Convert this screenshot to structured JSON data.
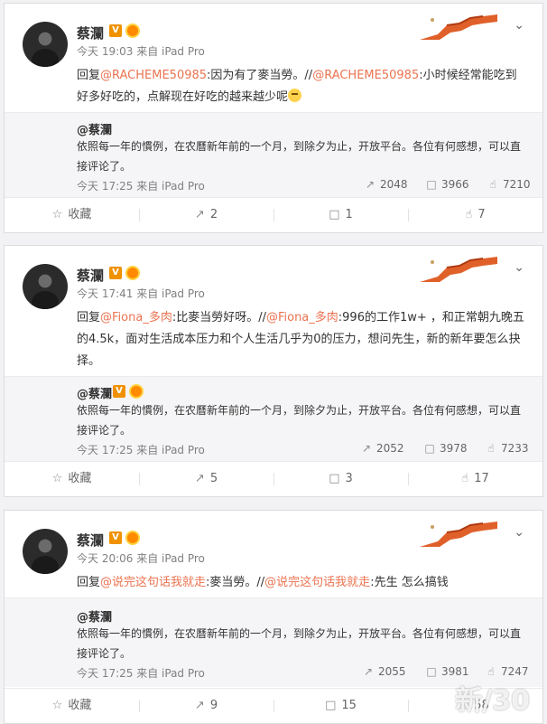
{
  "posts": [
    {
      "user": "蔡瀾",
      "time": "今天 19:03",
      "source": "来自 iPad Pro",
      "reply_prefix": "回复",
      "mention1": "@RACHEME50985",
      "text1": ":因为有了麥当勞。//",
      "mention2": "@RACHEME50985",
      "text2": ":小时候经常能吃到好多好吃的，点解现在好吃的越来越少呢",
      "quote": {
        "user": "@蔡瀾",
        "text": "依照每一年的慣例，在农曆新年前的一个月，到除夕为止，开放平台。各位有何感想，可以直接评论了。",
        "time": "今天 17:25",
        "source": "来自 iPad Pro",
        "forward": "2048",
        "comment": "3966",
        "like": "7210"
      },
      "actions": {
        "favorite": "收藏",
        "forward": "2",
        "comment": "1",
        "like": "7"
      }
    },
    {
      "user": "蔡瀾",
      "time": "今天 17:41",
      "source": "来自 iPad Pro",
      "reply_prefix": "回复",
      "mention1": "@Fiona_多肉",
      "text1": ":比麥当勞好呀。//",
      "mention2": "@Fiona_多肉",
      "text2": ":996的工作1w+ ，和正常朝九晚五的4.5k，面对生活成本压力和个人生活几乎为0的压力，想问先生，新的新年要怎么抉择。",
      "quote": {
        "user": "@蔡瀾",
        "text": "依照每一年的慣例，在农曆新年前的一个月，到除夕为止，开放平台。各位有何感想，可以直接评论了。",
        "time": "今天 17:25",
        "source": "来自 iPad Pro",
        "forward": "2052",
        "comment": "3978",
        "like": "7233"
      },
      "actions": {
        "favorite": "收藏",
        "forward": "5",
        "comment": "3",
        "like": "17"
      }
    },
    {
      "user": "蔡瀾",
      "time": "今天 20:06",
      "source": "来自 iPad Pro",
      "reply_prefix": "回复",
      "mention1": "@说完这句话我就走",
      "text1": ":麥当勞。//",
      "mention2": "@说完这句话我就走",
      "text2": ":先生 怎么搞钱",
      "quote": {
        "user": "@蔡瀾",
        "text": "依照每一年的慣例，在农曆新年前的一个月，到除夕为止，开放平台。各位有何感想，可以直接评论了。",
        "time": "今天 17:25",
        "source": "来自 iPad Pro",
        "forward": "2055",
        "comment": "3981",
        "like": "7247"
      },
      "actions": {
        "favorite": "收藏",
        "forward": "9",
        "comment": "15",
        "like": "58"
      }
    }
  ],
  "icons": {
    "favorite": "star-icon",
    "forward": "share-icon",
    "comment": "comment-icon",
    "like": "thumbs-up-icon",
    "more": "chevron-down-icon"
  },
  "colors": {
    "mention": "#eb7350",
    "badge": "#f09100"
  }
}
